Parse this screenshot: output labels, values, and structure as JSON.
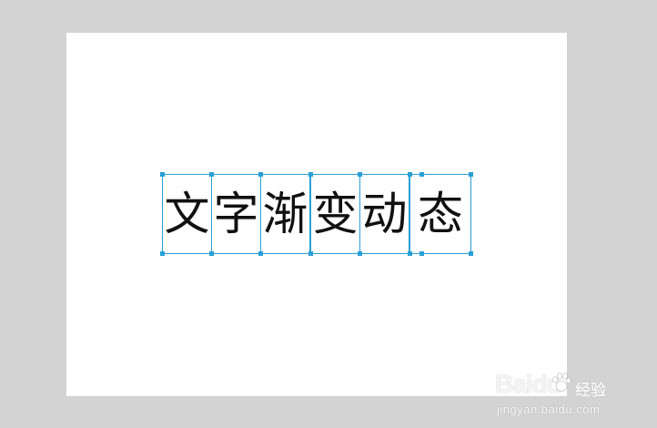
{
  "canvas": {
    "text": "文字渐变动态",
    "characters": [
      "文",
      "字",
      "渐",
      "变",
      "动",
      "态"
    ],
    "selection_color": "#2a9fd6",
    "text_color": "#111111",
    "artboard_color": "#ffffff",
    "workspace_color": "#d3d3d3"
  },
  "watermark": {
    "logo_text": "Bai",
    "logo_suffix": "du",
    "product": "经验",
    "url": "jingyan.baidu.com"
  }
}
